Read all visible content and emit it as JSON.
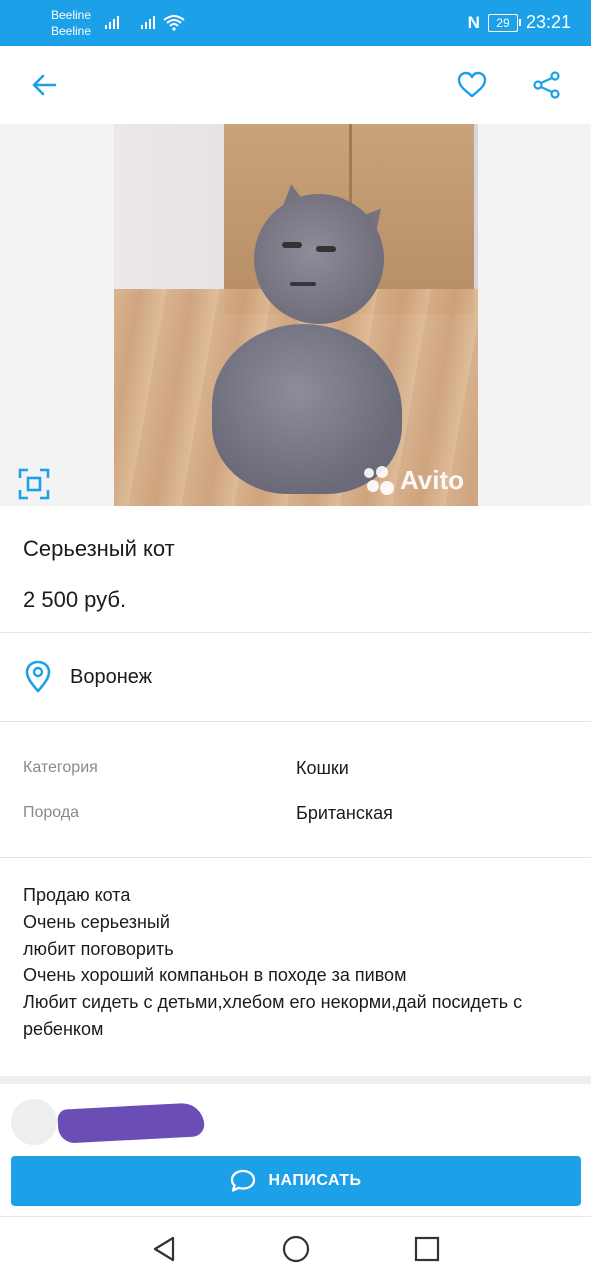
{
  "status_bar": {
    "carrier1": "Beeline",
    "carrier2": "Beeline",
    "battery": "29",
    "time": "23:21"
  },
  "header": {
    "back_icon": "arrow-left-icon",
    "favorite_icon": "heart-icon",
    "share_icon": "share-icon"
  },
  "photo": {
    "watermark": "Avito"
  },
  "listing": {
    "title": "Серьезный кот",
    "price": "2 500 руб.",
    "location": "Воронеж"
  },
  "params": [
    {
      "label": "Категория",
      "value": "Кошки"
    },
    {
      "label": "Порода",
      "value": "Британская"
    }
  ],
  "description": [
    "Продаю кота",
    "Очень серьезный",
    "любит поговорить",
    "Очень хороший компаньон в походе за пивом",
    "Любит сидеть с детьми,хлебом его некорми,дай посидеть с ребенком"
  ],
  "action": {
    "write_label": "НАПИСАТЬ"
  },
  "colors": {
    "accent": "#1ca0e8",
    "redaction": "#6a4db5"
  }
}
